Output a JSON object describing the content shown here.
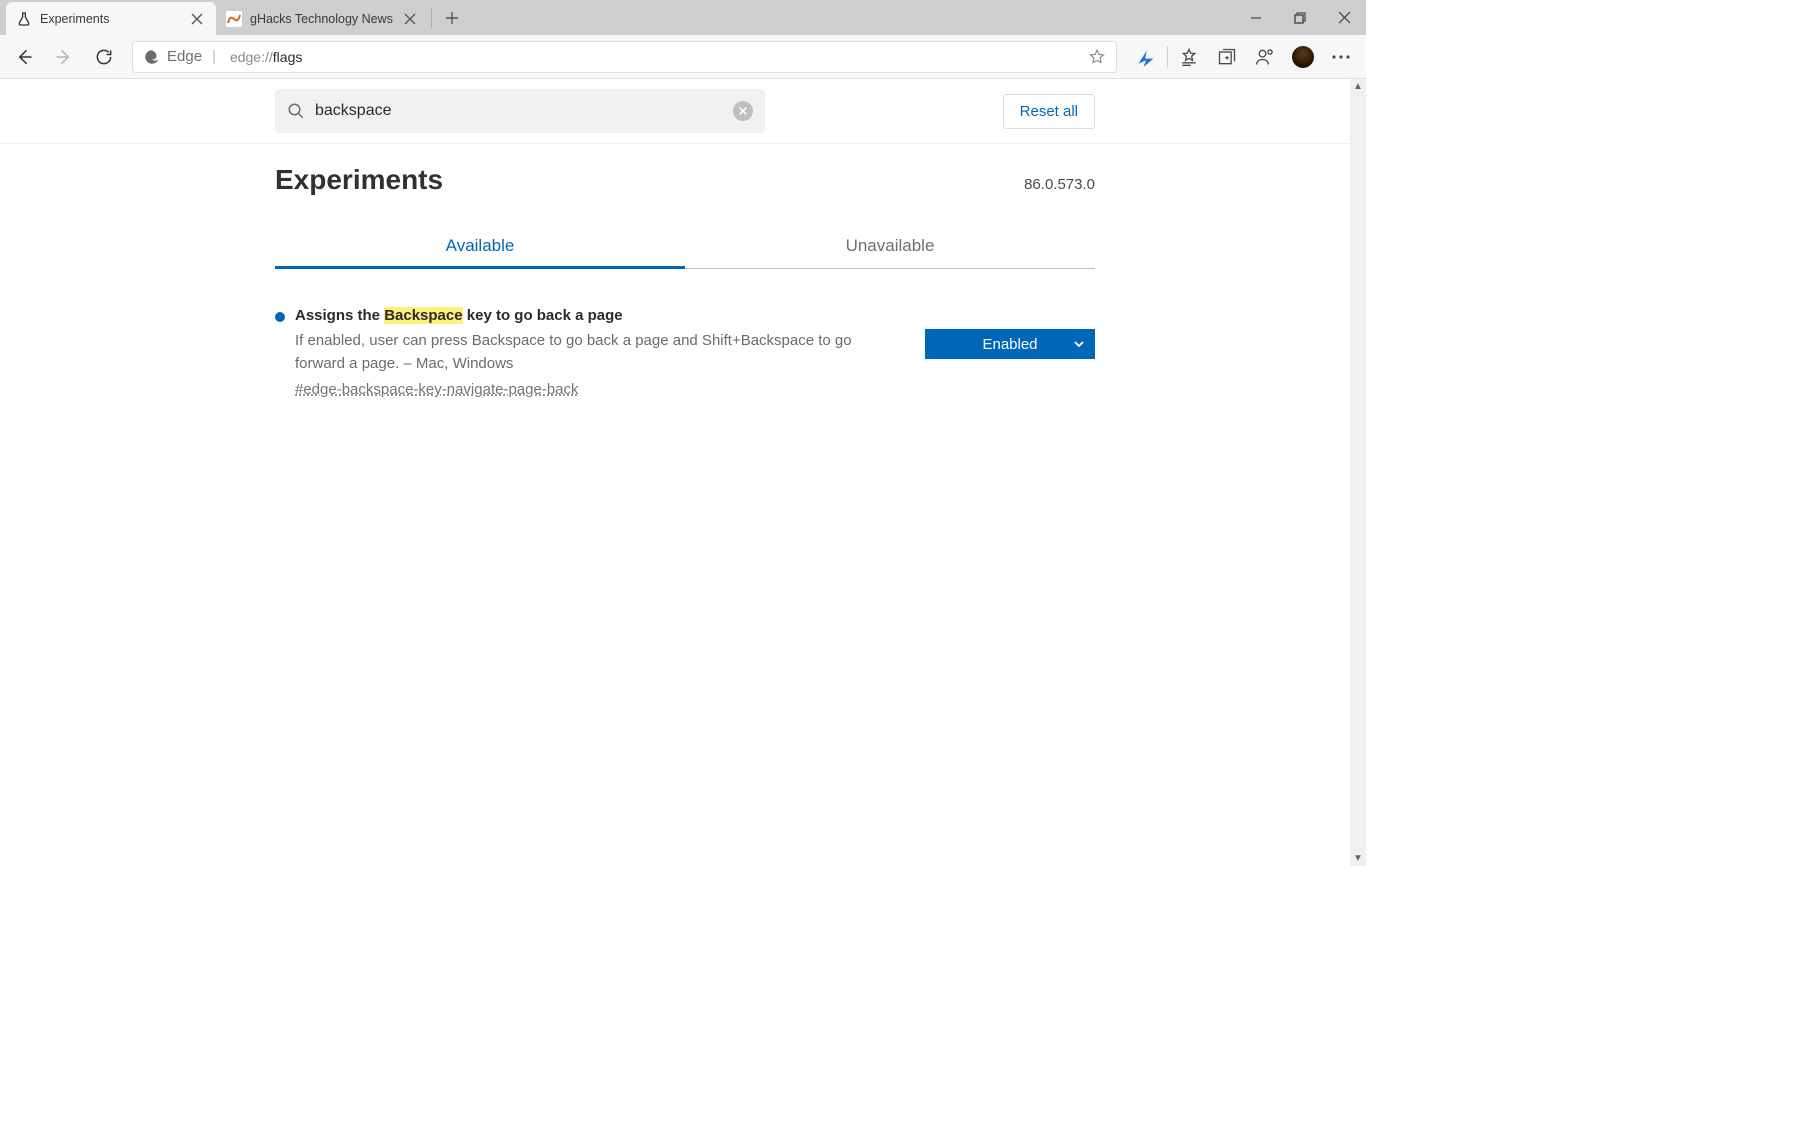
{
  "tabs": [
    {
      "title": "Experiments",
      "icon": "flask"
    },
    {
      "title": "gHacks Technology News",
      "icon": "ghacks"
    }
  ],
  "toolbar": {
    "edge_label": "Edge",
    "url_scheme": "edge://",
    "url_path": "flags"
  },
  "searchbar": {
    "value": "backspace",
    "reset_label": "Reset all"
  },
  "heading": "Experiments",
  "version": "86.0.573.0",
  "flag_tabs": {
    "available": "Available",
    "unavailable": "Unavailable"
  },
  "flag": {
    "title_pre": "Assigns the ",
    "title_hl": "Backspace",
    "title_post": " key to go back a page",
    "desc": "If enabled, user can press Backspace to go back a page and Shift+Backspace to go forward a page.  –  Mac, Windows",
    "id": "#edge-backspace-key-navigate-page-back",
    "state": "Enabled"
  }
}
